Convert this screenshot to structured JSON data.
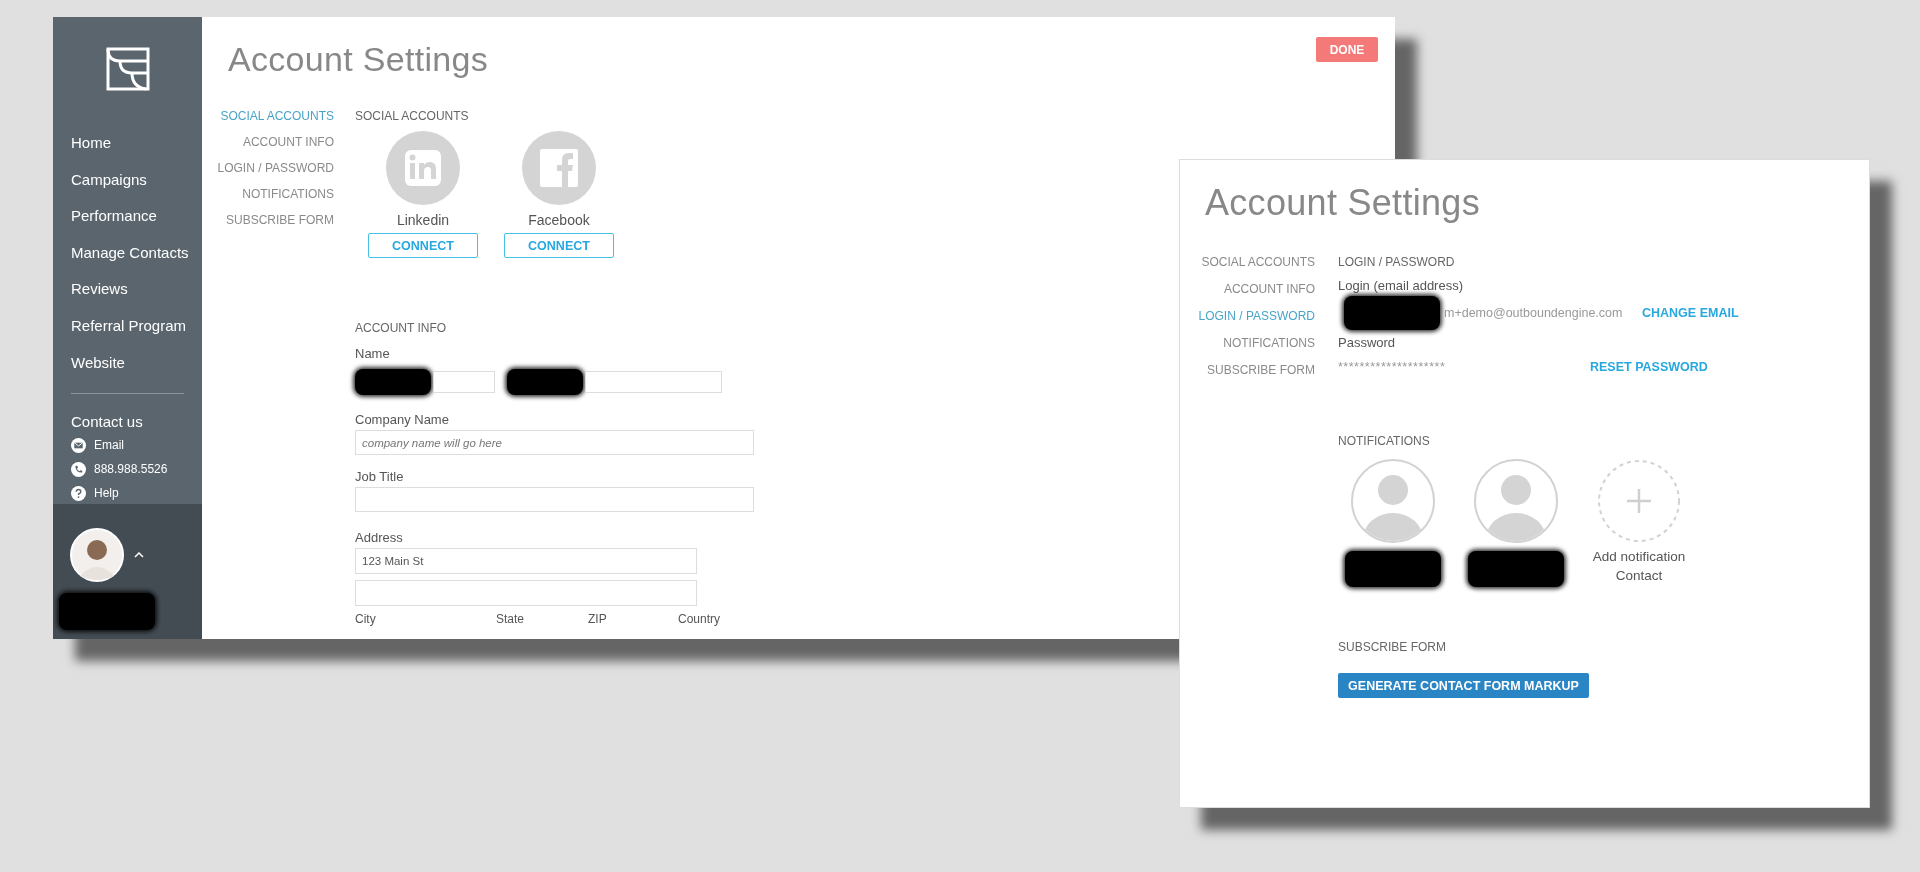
{
  "back_window": {
    "sidebar": {
      "nav_items": [
        {
          "label": "Home"
        },
        {
          "label": "Campaigns"
        },
        {
          "label": "Performance"
        },
        {
          "label": "Manage Contacts"
        },
        {
          "label": "Reviews"
        },
        {
          "label": "Referral Program"
        },
        {
          "label": "Website"
        }
      ],
      "contact": {
        "heading": "Contact us",
        "items": [
          {
            "kind": "email",
            "label": "Email"
          },
          {
            "kind": "phone",
            "label": "888.988.5526"
          },
          {
            "kind": "help",
            "label": "Help"
          }
        ]
      },
      "user": {
        "name_redacted": true
      }
    },
    "title": "Account Settings",
    "done_button": "DONE",
    "settings_nav": [
      {
        "label": "SOCIAL ACCOUNTS",
        "selected": true
      },
      {
        "label": "ACCOUNT INFO",
        "selected": false
      },
      {
        "label": "LOGIN / PASSWORD",
        "selected": false
      },
      {
        "label": "NOTIFICATIONS",
        "selected": false
      },
      {
        "label": "SUBSCRIBE FORM",
        "selected": false
      }
    ],
    "social_accounts": {
      "heading": "SOCIAL ACCOUNTS",
      "accounts": [
        {
          "kind": "linkedin",
          "name": "Linkedin",
          "button": "CONNECT"
        },
        {
          "kind": "facebook",
          "name": "Facebook",
          "button": "CONNECT"
        }
      ]
    },
    "account_info": {
      "heading": "ACCOUNT INFO",
      "name_label": "Name",
      "name_fields": [
        {
          "redacted": true
        },
        {
          "redacted": true
        }
      ],
      "company_label": "Company Name",
      "company_placeholder": "company name will go here",
      "job_title_label": "Job Title",
      "address_label": "Address",
      "address_line_1": "123 Main St",
      "address_columns": [
        "City",
        "State",
        "ZIP",
        "Country"
      ]
    }
  },
  "front_window": {
    "title": "Account Settings",
    "settings_nav": [
      {
        "label": "SOCIAL ACCOUNTS",
        "selected": false
      },
      {
        "label": "ACCOUNT INFO",
        "selected": false
      },
      {
        "label": "LOGIN / PASSWORD",
        "selected": true
      },
      {
        "label": "NOTIFICATIONS",
        "selected": false
      },
      {
        "label": "SUBSCRIBE FORM",
        "selected": false
      }
    ],
    "login": {
      "heading": "LOGIN / PASSWORD",
      "login_label": "Login (email address)",
      "email_redacted": true,
      "email": "m+demo@outboundengine.com",
      "change_email": "CHANGE EMAIL",
      "password_label": "Password",
      "password": "********************",
      "reset_password": "RESET PASSWORD"
    },
    "notifications": {
      "heading": "NOTIFICATIONS",
      "contacts": [
        {
          "kind": "contact",
          "name_redacted": true
        },
        {
          "kind": "contact",
          "name_redacted": true
        },
        {
          "kind": "add",
          "label": "Add notification Contact"
        }
      ]
    },
    "subscribe_form": {
      "heading": "SUBSCRIBE FORM",
      "button": "GENERATE CONTACT FORM MARKUP"
    }
  }
}
